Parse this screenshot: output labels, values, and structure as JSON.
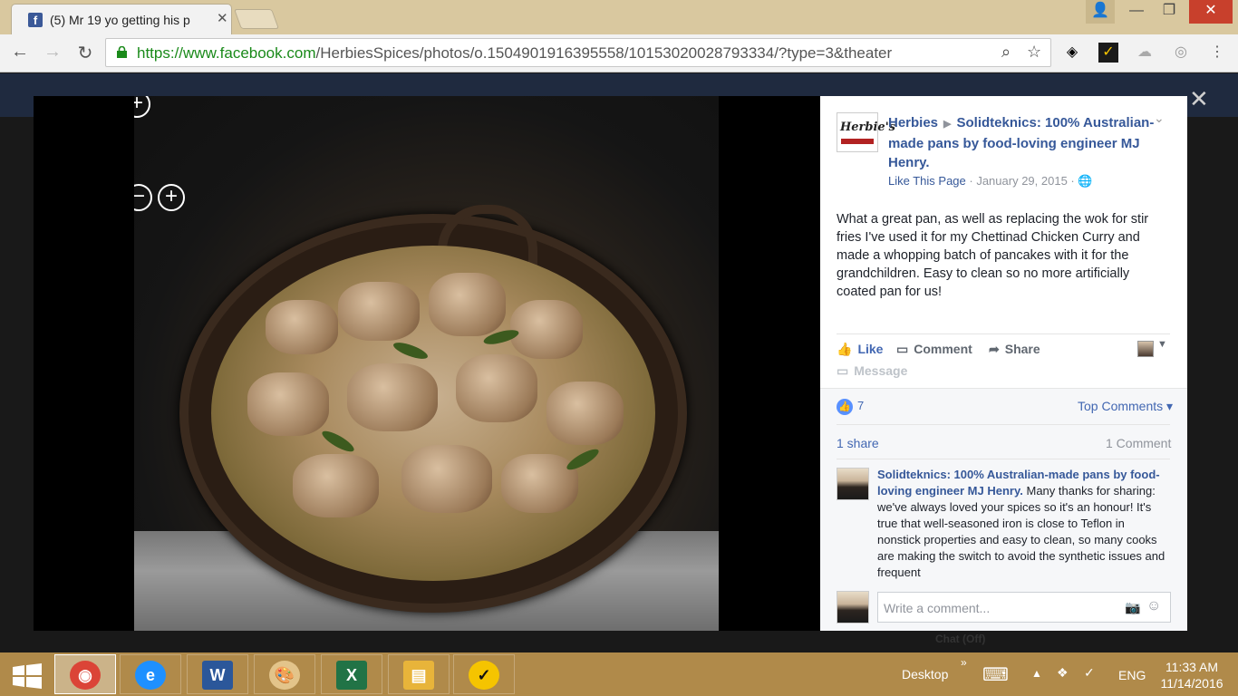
{
  "browser": {
    "tab_title": "(5) Mr 19 yo getting his p",
    "tab_favicon": "f",
    "tab_close": "✕",
    "url_scheme": "https://www.facebook.com",
    "url_path": "/HerbiesSpices/photos/o.1504901916395558/10153020028793334/?type=3&theater",
    "window_controls": {
      "user": "👤",
      "minimize": "—",
      "restore": "❐",
      "close": "✕"
    }
  },
  "photo": {
    "zoom_controls": [
      "−",
      "+"
    ],
    "close_symbol": "✕"
  },
  "post": {
    "page_name": "Herbies",
    "arrow": "▶",
    "target": "Solidteknics: 100% Australian-made pans by food-loving engineer MJ Henry.",
    "logo_text": "Herbie's",
    "like_page": "Like This Page",
    "separator": " · ",
    "date": "January 29, 2015",
    "separator2": " · ",
    "privacy_icon": "globe-icon",
    "text": "What a great pan, as well as replacing the wok for stir fries I've used it for my Chettinad Chicken Curry and made a whopping batch of pancakes with it for the grandchildren. Easy to clean so no more artificially coated pan for us!",
    "actions": {
      "like": "Like",
      "comment": "Comment",
      "share": "Share",
      "message": "Message"
    },
    "likes_count": "7",
    "top_comments": "Top Comments",
    "shares": "1 share",
    "comments_count": "1 Comment",
    "comment": {
      "author": "Solidteknics: 100% Australian-made pans by food-loving engineer MJ Henry.",
      "text": "Many thanks for sharing: we've always loved your spices so it's an honour! It's true that well-seasoned iron is close to Teflon in nonstick properties and easy to clean, so many cooks are making the switch to avoid the synthetic issues and frequent"
    },
    "write_placeholder": "Write a comment..."
  },
  "chat": {
    "label": "Chat (Off)"
  },
  "taskbar": {
    "apps": [
      {
        "name": "Chrome",
        "glyph": "◉",
        "color": "#db4437"
      },
      {
        "name": "Internet Explorer",
        "glyph": "e",
        "color": "#1e90ff"
      },
      {
        "name": "Word",
        "glyph": "W",
        "color": "#2b579a"
      },
      {
        "name": "Paint",
        "glyph": "🎨",
        "color": "#c08a3a"
      },
      {
        "name": "Excel",
        "glyph": "X",
        "color": "#217346"
      },
      {
        "name": "File Explorer",
        "glyph": "▤",
        "color": "#e8b43a"
      },
      {
        "name": "Norton",
        "glyph": "✓",
        "color": "#f5c400"
      }
    ],
    "desktop_label": "Desktop",
    "chevron": "»",
    "language": "ENG",
    "time": "11:33 AM",
    "date": "11/14/2016"
  },
  "colors": {
    "fb_blue": "#365899",
    "link_blue": "#4267b2",
    "taskbar": "#b08a4a",
    "tabbar": "#d9c89f"
  }
}
